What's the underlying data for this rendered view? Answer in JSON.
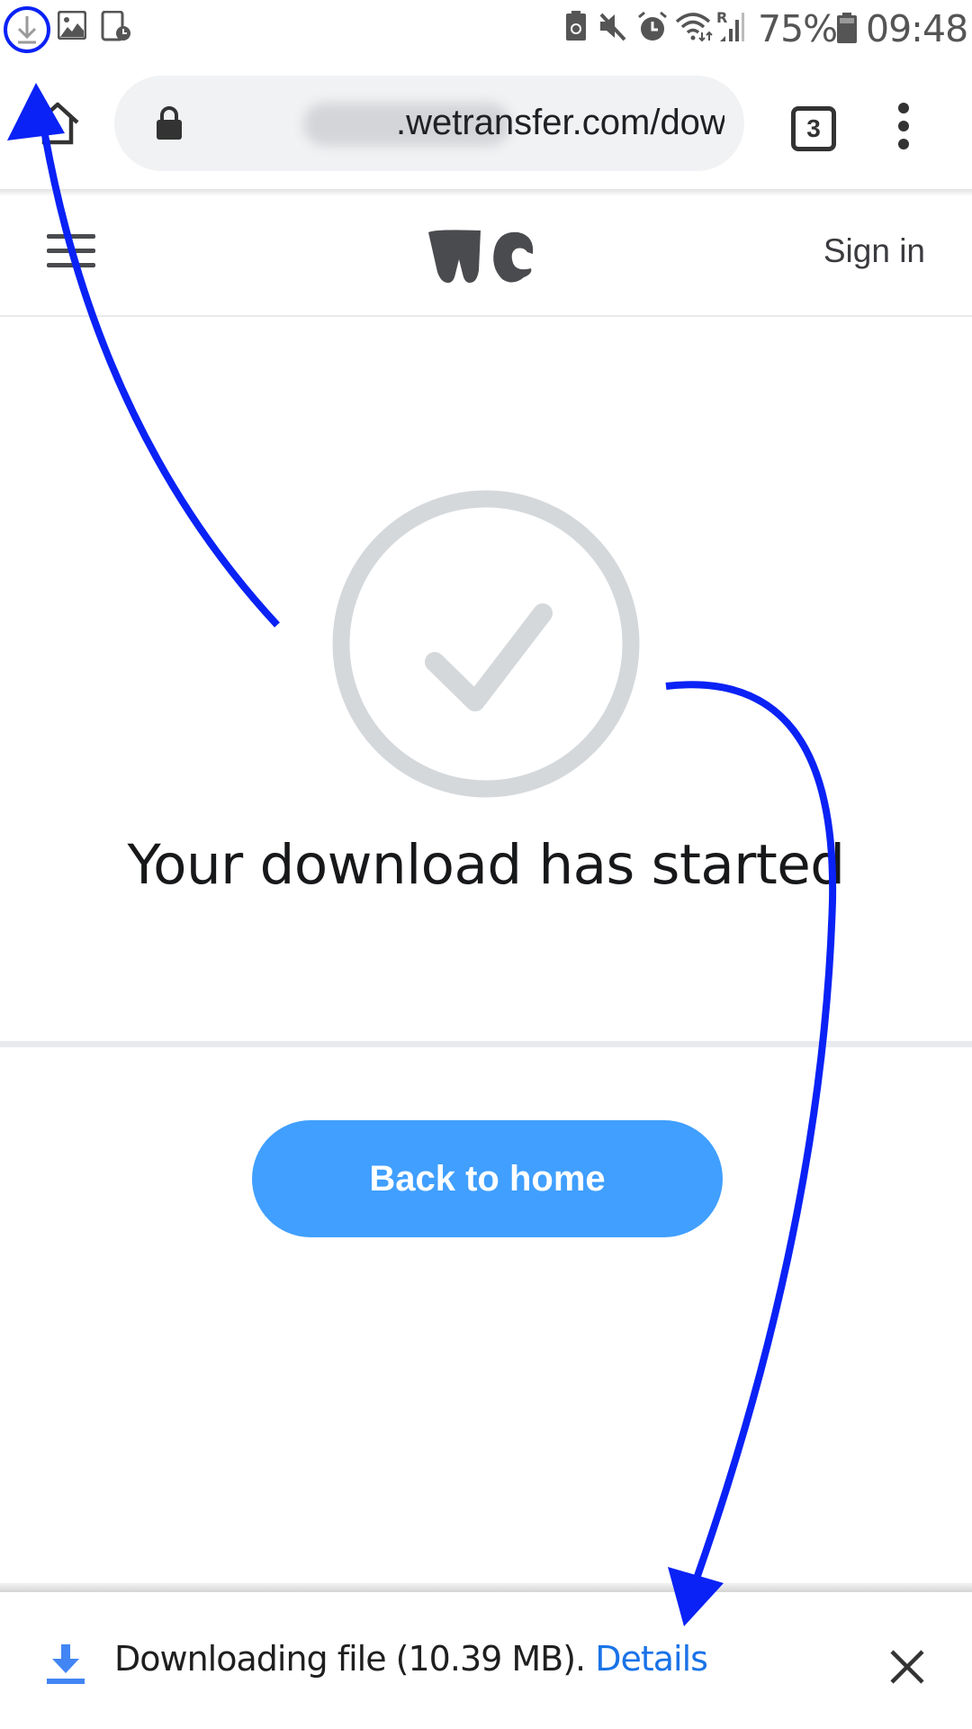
{
  "status_bar": {
    "left_icons": [
      "download-icon",
      "image-icon",
      "screen-timer-icon"
    ],
    "right_icons": [
      "battery-saver-icon",
      "mute-icon",
      "alarm-icon",
      "wifi-icon",
      "signal-icon"
    ],
    "roaming_indicator": "R",
    "battery_percent": "75%",
    "time": "09:48"
  },
  "browser": {
    "url_visible": ".wetransfer.com/down",
    "url_blurred": true,
    "tab_count": "3",
    "icons": [
      "home-icon",
      "lock-icon",
      "more-vert-icon"
    ]
  },
  "site_header": {
    "logo_text": "we",
    "sign_in_label": "Sign in"
  },
  "main": {
    "status_icon": "check-circle-icon",
    "heading": "Your download has started",
    "back_button_label": "Back to home"
  },
  "download_bar": {
    "message": "Downloading file (10.39 MB). ",
    "details_label": "Details",
    "close_icon": "close-icon"
  },
  "colors": {
    "accent_button": "#409fff",
    "annotation_arrow": "#0a22f5",
    "details_link": "#1a73e8",
    "check_gray": "#d5d8db"
  }
}
